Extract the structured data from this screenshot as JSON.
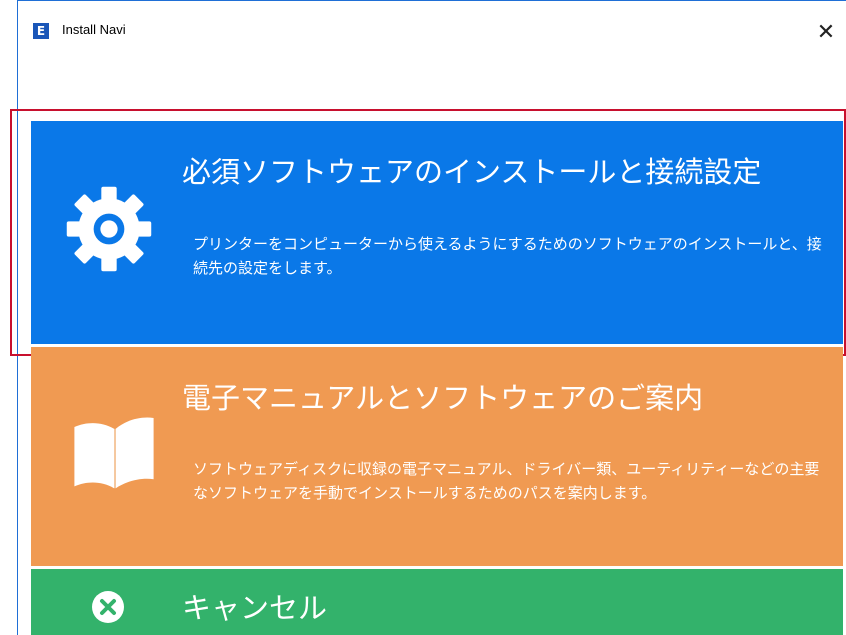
{
  "window": {
    "title": "Install Navi",
    "close_glyph": "✕"
  },
  "cards": {
    "install": {
      "title": "必須ソフトウェアのインストールと接続設定",
      "description": "プリンターをコンピューターから使えるようにするためのソフトウェアのインストールと、接続先の設定をします。",
      "icon": "gear-icon",
      "color": "#0a78e8"
    },
    "manual": {
      "title": "電子マニュアルとソフトウェアのご案内",
      "description": "ソフトウェアディスクに収録の電子マニュアル、ドライバー類、ユーティリティーなどの主要なソフトウェアを手動でインストールするためのパスを案内します。",
      "icon": "book-icon",
      "color": "#f09a52"
    },
    "cancel": {
      "title": "キャンセル",
      "icon": "cancel-icon",
      "color": "#33b26b"
    }
  }
}
